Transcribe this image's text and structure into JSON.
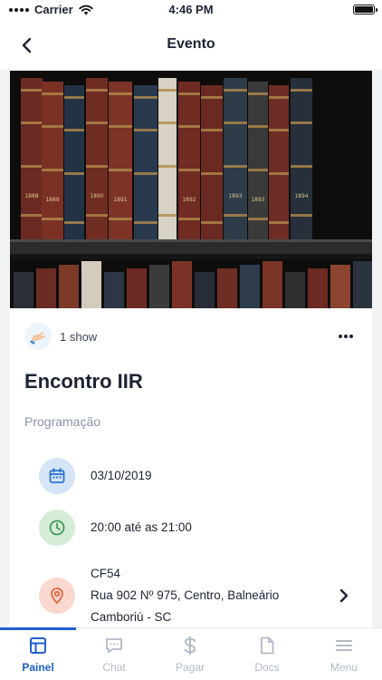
{
  "status_bar": {
    "carrier": "Carrier",
    "time": "4:46 PM"
  },
  "nav": {
    "title": "Evento",
    "back_icon": "chevron-left-icon"
  },
  "event": {
    "show_count": "1 show",
    "title": "Encontro IIR",
    "section_label": "Programação",
    "date": "03/10/2019",
    "time": "20:00 até as 21:00",
    "place_name": "CF54",
    "address_line1": "Rua 902 Nº 975,  Centro, Balneário",
    "address_line2": "Camboriú - SC"
  },
  "hero_book_labels": [
    "1888",
    "1889",
    "1890",
    "1891",
    "1892",
    "1893",
    "1893",
    "1894"
  ],
  "colors": {
    "accent": "#1f5fcf",
    "date_icon_bg": "#d5e4f7",
    "date_icon": "#2d73d2",
    "time_icon_bg": "#d5ecd9",
    "time_icon": "#3f9d57",
    "place_icon_bg": "#fbd8cf",
    "place_icon": "#e9643f"
  },
  "tabs": [
    {
      "label": "Painel",
      "icon": "layout-icon",
      "active": true
    },
    {
      "label": "Chat",
      "icon": "chat-icon",
      "active": false
    },
    {
      "label": "Pagar",
      "icon": "dollar-icon",
      "active": false
    },
    {
      "label": "Docs",
      "icon": "document-icon",
      "active": false
    },
    {
      "label": "Menu",
      "icon": "menu-icon",
      "active": false
    }
  ]
}
